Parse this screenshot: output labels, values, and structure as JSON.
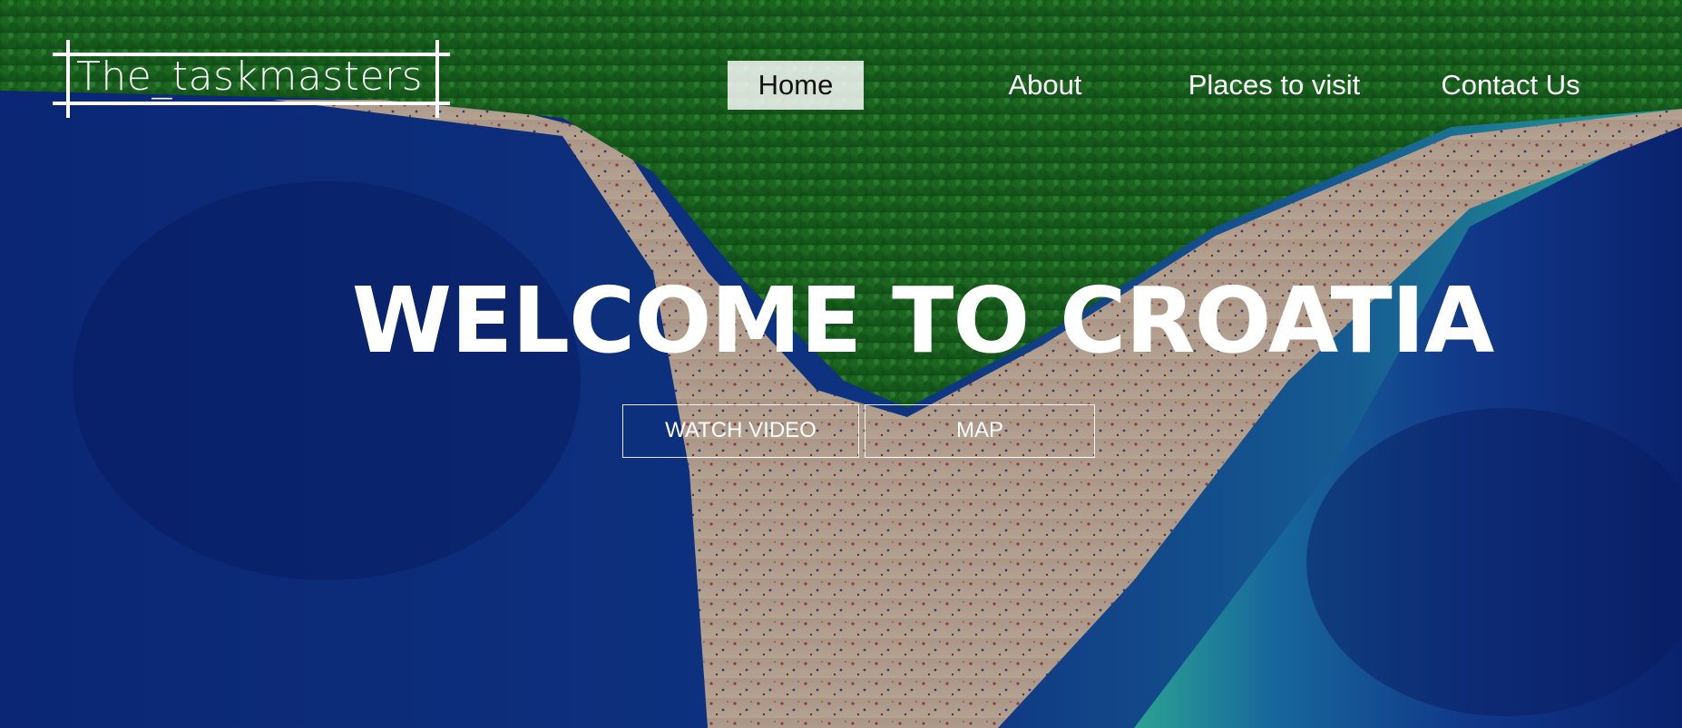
{
  "header": {
    "logo_text": "The_taskmasters"
  },
  "nav": {
    "items": [
      {
        "label": "Home",
        "active": true
      },
      {
        "label": "About",
        "active": false
      },
      {
        "label": "Places to visit",
        "active": false
      },
      {
        "label": "Contact Us",
        "active": false
      }
    ]
  },
  "hero": {
    "headline": "WELCOME TO CROATIA",
    "buttons": {
      "watch_video": "WATCH VIDEO",
      "map": "MAP"
    }
  },
  "colors": {
    "text": "#ffffff",
    "nav_active_bg": "#d9dcd6",
    "sea_deep": "#0a2a8a",
    "sea_shallow": "#2fb7b0",
    "forest": "#1f7a2a",
    "sand": "#d8c2ad"
  }
}
